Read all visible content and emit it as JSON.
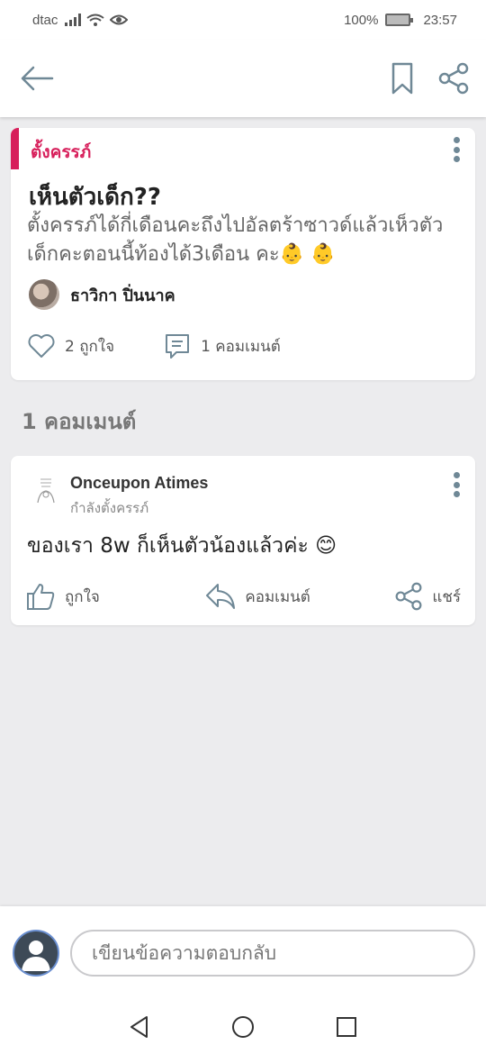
{
  "status_bar": {
    "carrier": "dtac",
    "battery": "100%",
    "time": "23:57"
  },
  "app_bar": {
    "back_icon": "arrow-left-icon",
    "bookmark_icon": "bookmark-icon",
    "share_icon": "share-icon"
  },
  "post": {
    "category": "ตั้งครรภ์",
    "title": "เห็นตัวเด็ก??",
    "body": "ตั้งครรภ์ได้กี่เดือนคะถึงไปอัลตร้าซาวด์แล้วเห็วตัวเด็กคะตอนนี้ท้องได้3เดือน คะ👶 👶",
    "author": "ธาวิกา ปิ่นนาค",
    "likes": "2 ถูกใจ",
    "comments": "1 คอมเมนต์"
  },
  "comments_section": {
    "title": "1 คอมเมนต์"
  },
  "comment": {
    "author": "Onceupon Atimes",
    "subtitle": "กำลังตั้งครรภ์",
    "text": "ของเรา 8w ก็เห็นตัวน้องแล้วค่ะ 😊",
    "like_label": "ถูกใจ",
    "comment_label": "คอมเมนต์",
    "share_label": "แชร์"
  },
  "composer": {
    "placeholder": "เขียนข้อความตอบกลับ"
  },
  "colors": {
    "accent": "#d71f5b",
    "icon": "#6f8896",
    "background": "#ececee"
  }
}
